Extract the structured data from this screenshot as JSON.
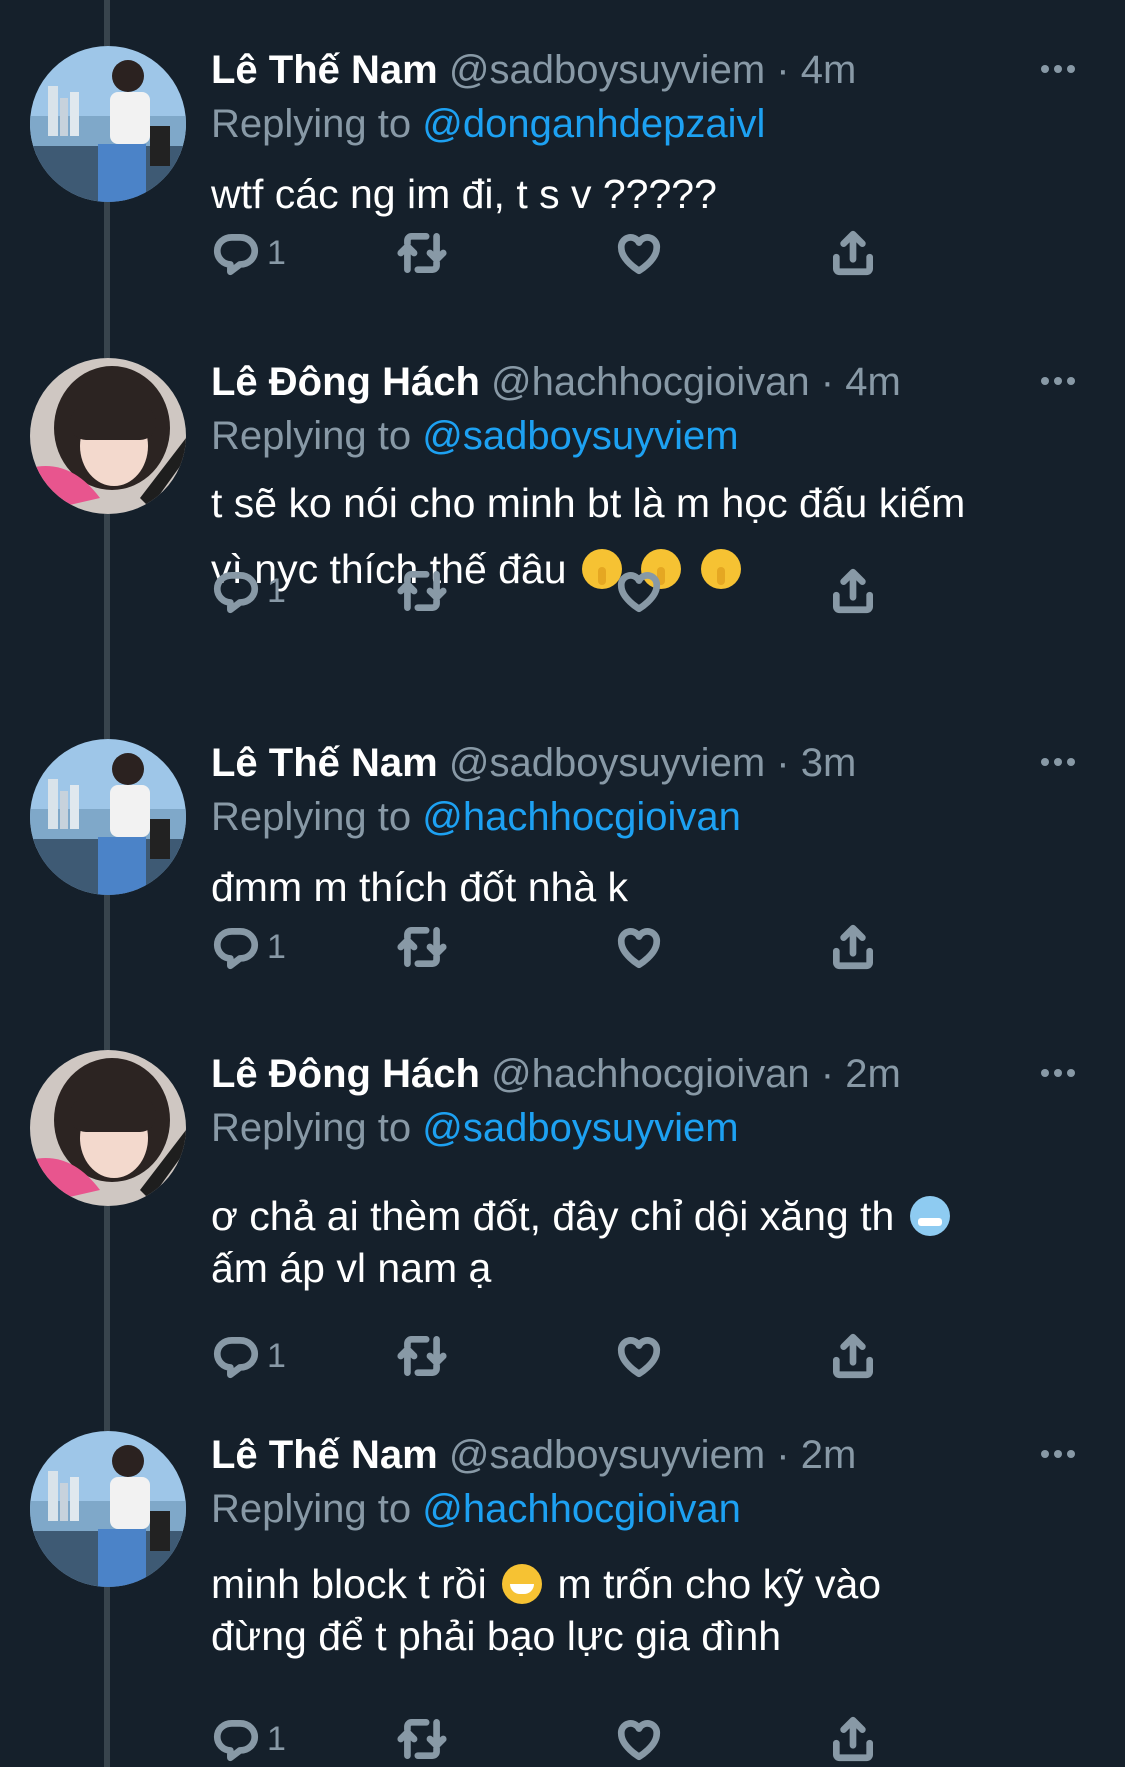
{
  "colors": {
    "background": "#15202b",
    "secondary": "#8899a6",
    "link": "#1da1f2"
  },
  "tweets": [
    {
      "name": "Lê Thế Nam",
      "handle": "@sadboysuyviem",
      "dot": "·",
      "time": "4m",
      "replying_label": "Replying to",
      "replying_to": "@donganhdepzaivl",
      "text_parts": [
        "wtf các ng im đi, t s v ?????"
      ],
      "reply_count": "1",
      "avatar": "person-on-boat"
    },
    {
      "name": "Lê Đông Hách",
      "handle": "@hachhocgioivan",
      "dot": "·",
      "time": "4m",
      "replying_label": "Replying to",
      "replying_to": "@sadboysuyviem",
      "text_line1": "t sẽ ko nói cho minh bt là m học đấu kiếm",
      "text_line2": "vì nyc thích thế đâu",
      "reply_count": "1",
      "avatar": "portrait-pink-hoodie",
      "emoji": "shushing-face"
    },
    {
      "name": "Lê Thế Nam",
      "handle": "@sadboysuyviem",
      "dot": "·",
      "time": "3m",
      "replying_label": "Replying to",
      "replying_to": "@hachhocgioivan",
      "text_parts": [
        "đmm m thích đốt nhà k"
      ],
      "reply_count": "1",
      "avatar": "person-on-boat"
    },
    {
      "name": "Lê Đông Hách",
      "handle": "@hachhocgioivan",
      "dot": "·",
      "time": "2m",
      "replying_label": "Replying to",
      "replying_to": "@sadboysuyviem",
      "text_line1": "ơ chả ai thèm đốt, đây chỉ dội xăng th",
      "text_line2": "ấm áp vl nam ạ",
      "reply_count": "1",
      "avatar": "portrait-pink-hoodie",
      "emoji": "cold-face"
    },
    {
      "name": "Lê Thế Nam",
      "handle": "@sadboysuyviem",
      "dot": "·",
      "time": "2m",
      "replying_label": "Replying to",
      "replying_to": "@hachhocgioivan",
      "text_line1a": "minh block t rồi",
      "text_line1b": " m trốn cho kỹ vào",
      "text_line2": "đừng để t phải bạo lực gia đình",
      "reply_count": "1",
      "avatar": "person-on-boat",
      "emoji": "grinning-face"
    }
  ]
}
